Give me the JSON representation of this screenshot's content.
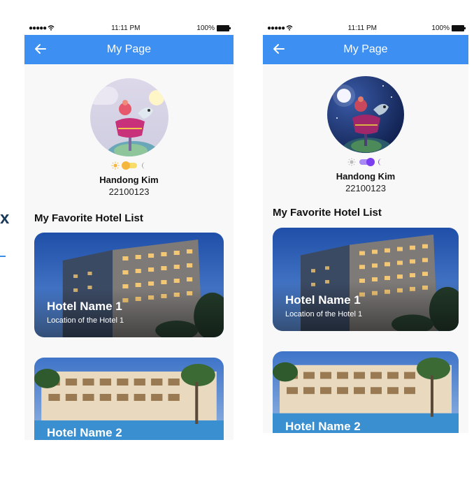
{
  "edge_fragment": {
    "char": "x"
  },
  "screens": [
    {
      "status": {
        "time": "11:11 PM",
        "battery": "100%"
      },
      "appbar": {
        "title": "My Page"
      },
      "profile": {
        "name": "Handong Kim",
        "id": "22100123",
        "theme": "light"
      },
      "section_title": "My Favorite Hotel List",
      "hotels": [
        {
          "name": "Hotel Name 1",
          "location": "Location of the Hotel 1"
        },
        {
          "name": "Hotel Name 2"
        }
      ]
    },
    {
      "status": {
        "time": "11:11 PM",
        "battery": "100%"
      },
      "appbar": {
        "title": "My Page"
      },
      "profile": {
        "name": "Handong Kim",
        "id": "22100123",
        "theme": "dark"
      },
      "section_title": "My Favorite Hotel List",
      "hotels": [
        {
          "name": "Hotel Name 1",
          "location": "Location of the Hotel 1"
        },
        {
          "name": "Hotel Name 2"
        }
      ]
    }
  ],
  "colors": {
    "appbar": "#3d8ff1",
    "light_toggle": "#f5b63e",
    "dark_toggle": "#7a3ff0"
  },
  "icons": [
    "back-arrow-icon",
    "wifi-icon",
    "battery-icon",
    "sun-icon",
    "moon-icon"
  ]
}
